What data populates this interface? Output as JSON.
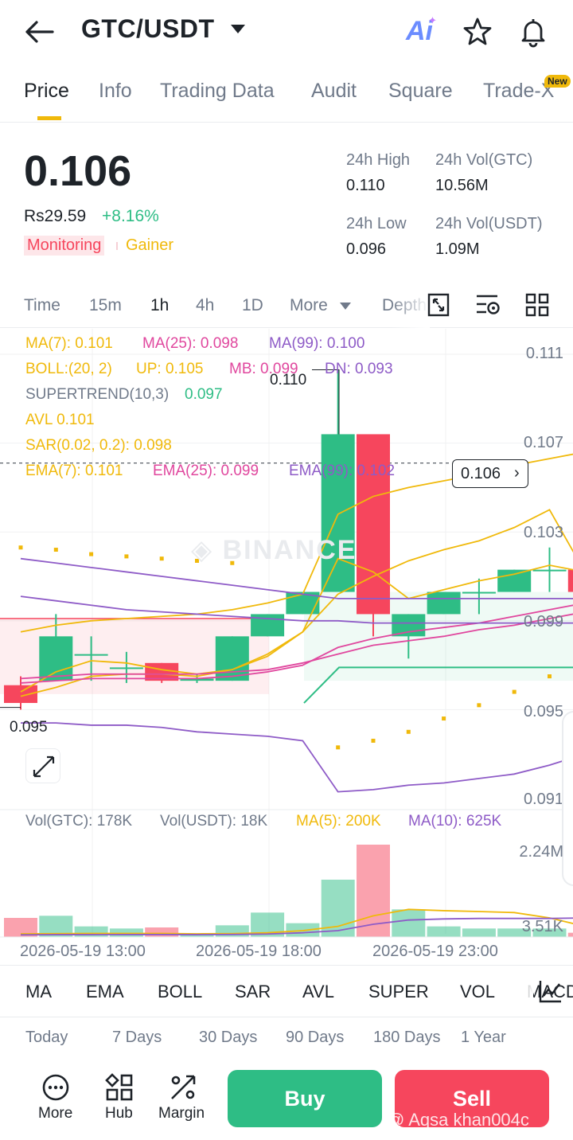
{
  "header": {
    "pair": "GTC/USDT",
    "ai_label": "Ai"
  },
  "tabs": [
    {
      "label": "Price",
      "active": true
    },
    {
      "label": "Info"
    },
    {
      "label": "Trading Data"
    },
    {
      "label": "Audit"
    },
    {
      "label": "Square"
    },
    {
      "label": "Trade-X",
      "badge": "New"
    }
  ],
  "price": {
    "last": "0.106",
    "fiat": "Rs29.59",
    "change": "+8.16%",
    "tags": [
      "Monitoring",
      "Gainer"
    ]
  },
  "stats": {
    "high_label": "24h High",
    "high": "0.110",
    "vol_gtc_label": "24h Vol(GTC)",
    "vol_gtc": "10.56M",
    "low_label": "24h Low",
    "low": "0.096",
    "vol_usdt_label": "24h Vol(USDT)",
    "vol_usdt": "1.09M"
  },
  "intervals": [
    "Time",
    "15m",
    "1h",
    "4h",
    "1D",
    "More",
    "Depth"
  ],
  "active_interval": "1h",
  "indicators": {
    "ma7": "MA(7): 0.101",
    "ma25": "MA(25): 0.098",
    "ma99": "MA(99): 0.100",
    "boll": "BOLL:(20, 2)",
    "boll_up": "UP: 0.105",
    "boll_mb": "MB: 0.099",
    "boll_dn": "DN: 0.093",
    "supertrend": "SUPERTREND(10,3)",
    "supertrend_val": "0.097",
    "avl": "AVL 0.101",
    "sar": "SAR(0.02, 0.2): 0.098",
    "ema7": "EMA(7): 0.101",
    "ema25": "EMA(25): 0.099",
    "ema99": "EMA(99): 0.102",
    "vol_gtc": "Vol(GTC): 178K",
    "vol_usdt": "Vol(USDT): 18K",
    "vol_ma5": "MA(5): 200K",
    "vol_ma10": "MA(10): 625K"
  },
  "chart_data": {
    "type": "candlestick",
    "y_ticks": [
      "0.111",
      "0.107",
      "0.103",
      "0.099",
      "0.095",
      "0.091"
    ],
    "vol_ticks": [
      "2.24M",
      "3.51K"
    ],
    "x_ticks": [
      "2026-05-19 13:00",
      "2026-05-19 18:00",
      "2026-05-19 23:00"
    ],
    "current_price": "0.106",
    "high_marker": "0.110",
    "low_marker": "0.095",
    "candles": [
      {
        "o": 0.0961,
        "h": 0.0965,
        "l": 0.095,
        "c": 0.0953
      },
      {
        "o": 0.0963,
        "h": 0.0993,
        "l": 0.0963,
        "c": 0.0983
      },
      {
        "o": 0.0975,
        "h": 0.0983,
        "l": 0.0963,
        "c": 0.0975
      },
      {
        "o": 0.0969,
        "h": 0.0976,
        "l": 0.0962,
        "c": 0.0969
      },
      {
        "o": 0.0971,
        "h": 0.0971,
        "l": 0.0962,
        "c": 0.0963
      },
      {
        "o": 0.0963,
        "h": 0.0966,
        "l": 0.0962,
        "c": 0.0964
      },
      {
        "o": 0.0963,
        "h": 0.0983,
        "l": 0.0963,
        "c": 0.0983
      },
      {
        "o": 0.0983,
        "h": 0.0993,
        "l": 0.0983,
        "c": 0.0993
      },
      {
        "o": 0.0993,
        "h": 0.1003,
        "l": 0.0993,
        "c": 0.1003
      },
      {
        "o": 0.1003,
        "h": 0.1103,
        "l": 0.1003,
        "c": 0.1074
      },
      {
        "o": 0.1074,
        "h": 0.1074,
        "l": 0.0983,
        "c": 0.0993
      },
      {
        "o": 0.0983,
        "h": 0.0993,
        "l": 0.0973,
        "c": 0.0993
      },
      {
        "o": 0.0993,
        "h": 0.1003,
        "l": 0.0993,
        "c": 0.1003
      },
      {
        "o": 0.1003,
        "h": 0.1009,
        "l": 0.0993,
        "c": 0.1003
      },
      {
        "o": 0.1003,
        "h": 0.1013,
        "l": 0.1003,
        "c": 0.1013
      },
      {
        "o": 0.1013,
        "h": 0.1023,
        "l": 0.1003,
        "c": 0.1013
      },
      {
        "o": 0.1013,
        "h": 0.1013,
        "l": 0.1003,
        "c": 0.1003
      }
    ],
    "volumes": [
      180,
      200,
      100,
      80,
      90,
      20,
      110,
      230,
      130,
      540,
      870,
      260,
      100,
      80,
      80,
      80,
      40
    ]
  },
  "indicator_tabs": [
    "MA",
    "EMA",
    "BOLL",
    "SAR",
    "AVL",
    "SUPER",
    "VOL",
    "MACD"
  ],
  "performance": [
    "Today",
    "7 Days",
    "30 Days",
    "90 Days",
    "180 Days",
    "1 Year"
  ],
  "bottom": {
    "more": "More",
    "hub": "Hub",
    "margin": "Margin",
    "buy": "Buy",
    "sell": "Sell",
    "credit": "@ Aqsa khan004c"
  },
  "colors": {
    "up": "#2ebd85",
    "down": "#f6465d",
    "accent": "#f0b90b",
    "ma7": "#f0b90b",
    "ma25": "#e0479e",
    "ma99": "#8e5bc7"
  }
}
